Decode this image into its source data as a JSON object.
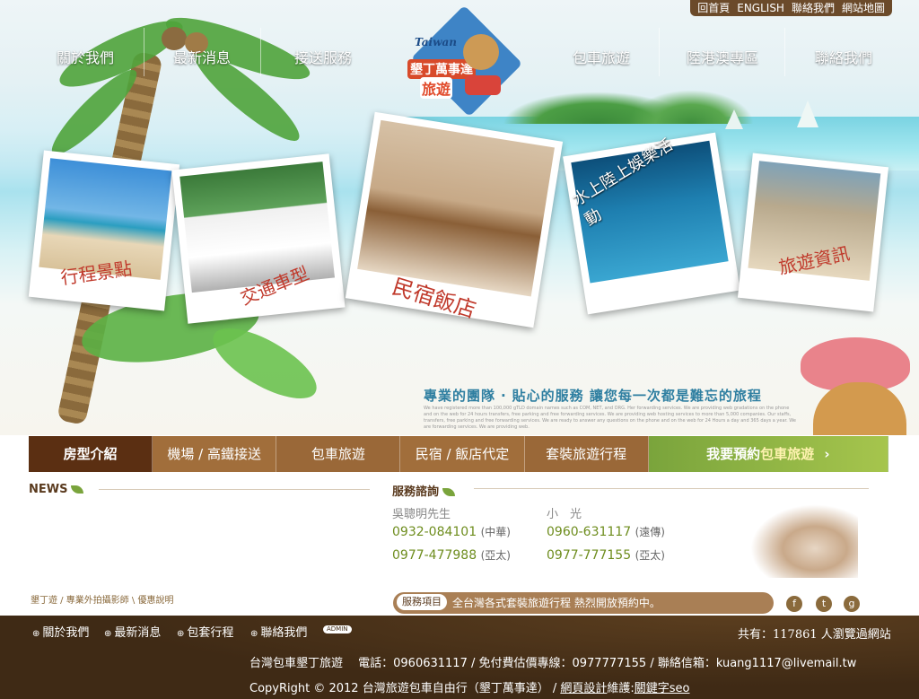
{
  "topbar": {
    "items": [
      "回首頁",
      "ENGLISH",
      "聯絡我們",
      "網站地圖"
    ]
  },
  "nav": {
    "items": [
      "關於我們",
      "最新消息",
      "接送服務",
      "包車旅遊",
      "陸港澳專區",
      "聯絡我們"
    ]
  },
  "logo": {
    "text_top": "Taiwan",
    "text_main": "墾丁萬事達",
    "text_sub": "旅遊"
  },
  "photos": [
    {
      "caption": "行程景點"
    },
    {
      "caption": "交通車型"
    },
    {
      "caption": "民宿飯店"
    },
    {
      "caption": "水上陸上娛樂活動"
    },
    {
      "caption": "旅遊資訊"
    }
  ],
  "tagline": "專業的團隊 ‧ 貼心的服務 讓您每一次都是難忘的旅程",
  "tagline_en": "We have registered more than 100,000 gTLD domain names such as COM, NET, and ORG. Her forwarding services. We are providing web gradations on the phone and on the web for 24 hours transfers, free parking and free forwarding services. We are providing web hosting services to more than 5,000 companies. Our staffs, transfers, free parking and free forwarding services. We are ready to answer any questions on the phone and on the web for 24 Hours a day and 365 days a year. We are forwarding services. We are providing web.",
  "subbar": {
    "items": [
      "房型介紹",
      "機場 / 高鐵接送",
      "包車旅遊",
      "民宿 / 飯店代定",
      "套裝旅遊行程"
    ],
    "cta_prefix": "我要預約",
    "cta_highlight": "包車旅遊",
    "cta_arrow": "›"
  },
  "news": {
    "heading": "NEWS",
    "links": "墾丁遊 / 專業外拍攝影師 \\ 優惠說明"
  },
  "service": {
    "heading": "服務諮詢",
    "contacts": [
      {
        "name": "吳聰明先生",
        "phones": [
          {
            "num": "0932-084101",
            "carrier": "(中華)"
          },
          {
            "num": "0977-477988",
            "carrier": "(亞太)"
          }
        ]
      },
      {
        "name": "小　光",
        "phones": [
          {
            "num": "0960-631117",
            "carrier": "(遠傳)"
          },
          {
            "num": "0977-777155",
            "carrier": "(亞太)"
          }
        ]
      }
    ]
  },
  "ticker": {
    "tag": "服務項目",
    "text": "全台灣各式套裝旅遊行程 熱烈開放預約中。"
  },
  "social": [
    "f",
    "t",
    "g"
  ],
  "footer": {
    "links": [
      "關於我們",
      "最新消息",
      "包套行程",
      "聯絡我們"
    ],
    "admin": "ADMIN",
    "visits_prefix": "共有：",
    "visits_count": "117861",
    "visits_suffix": " 人瀏覽過網站",
    "line1": "台灣包車墾丁旅遊　 電話：0960631117 / 免付費估價專線：0977777155 / 聯絡信箱：kuang1117@livemail.tw",
    "line2_prefix": "CopyRight © 2012 台灣旅遊包車自由行（墾丁萬事達） / ",
    "line2_link1": "網頁設計",
    "line2_mid": "維護:",
    "line2_link2": "關鍵字seo"
  },
  "colors": {
    "brown_dark": "#5b2f12",
    "brown": "#9a6a3a",
    "green_cta": "#7aa43c",
    "phone_green": "#6e8d1e",
    "tagline_blue": "#2f7fa1",
    "footer_bg": "#3f2a15"
  }
}
